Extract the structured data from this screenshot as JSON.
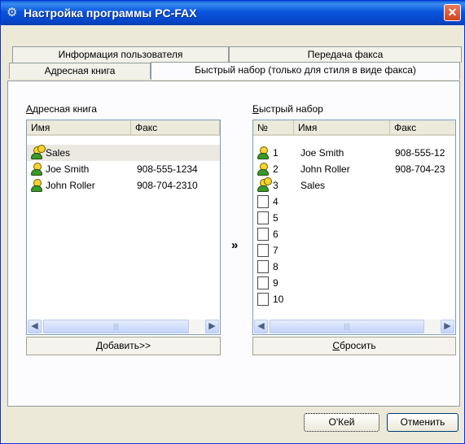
{
  "window": {
    "title": "Настройка программы PC-FAX",
    "close_glyph": "✕",
    "app_glyph": "⚙"
  },
  "tabs": [
    {
      "label": "Информация пользователя"
    },
    {
      "label": "Передача факса"
    },
    {
      "label": "Адресная книга"
    },
    {
      "label": "Быстрый набор (только для стиля в виде факса)"
    }
  ],
  "address_book": {
    "group_label": "Адресная книга",
    "columns": {
      "name": "Имя",
      "fax": "Факс"
    },
    "rows": [
      {
        "icon": "group-icon",
        "name": "Sales",
        "fax": ""
      },
      {
        "icon": "person-icon",
        "name": "Joe Smith",
        "fax": "908-555-1234"
      },
      {
        "icon": "person-icon",
        "name": "John Roller",
        "fax": "908-704-2310"
      }
    ],
    "add_button": "Добавить>>"
  },
  "transfer_arrow": "»",
  "speed_dial": {
    "group_label": "Быстрый набор",
    "columns": {
      "number": "№",
      "name": "Имя",
      "fax": "Факс"
    },
    "rows": [
      {
        "num": "1",
        "icon": "person-icon",
        "name": "Joe Smith",
        "fax": "908-555-12"
      },
      {
        "num": "2",
        "icon": "person-icon",
        "name": "John Roller",
        "fax": "908-704-23"
      },
      {
        "num": "3",
        "icon": "group-icon",
        "name": "Sales",
        "fax": ""
      },
      {
        "num": "4",
        "icon": "empty",
        "name": "",
        "fax": ""
      },
      {
        "num": "5",
        "icon": "empty",
        "name": "",
        "fax": ""
      },
      {
        "num": "6",
        "icon": "empty",
        "name": "",
        "fax": ""
      },
      {
        "num": "7",
        "icon": "empty",
        "name": "",
        "fax": ""
      },
      {
        "num": "8",
        "icon": "empty",
        "name": "",
        "fax": ""
      },
      {
        "num": "9",
        "icon": "empty",
        "name": "",
        "fax": ""
      },
      {
        "num": "10",
        "icon": "empty",
        "name": "",
        "fax": ""
      }
    ],
    "reset_button": "Сбросить"
  },
  "footer": {
    "ok_button": "О'Кей",
    "cancel_button": "Отменить"
  }
}
